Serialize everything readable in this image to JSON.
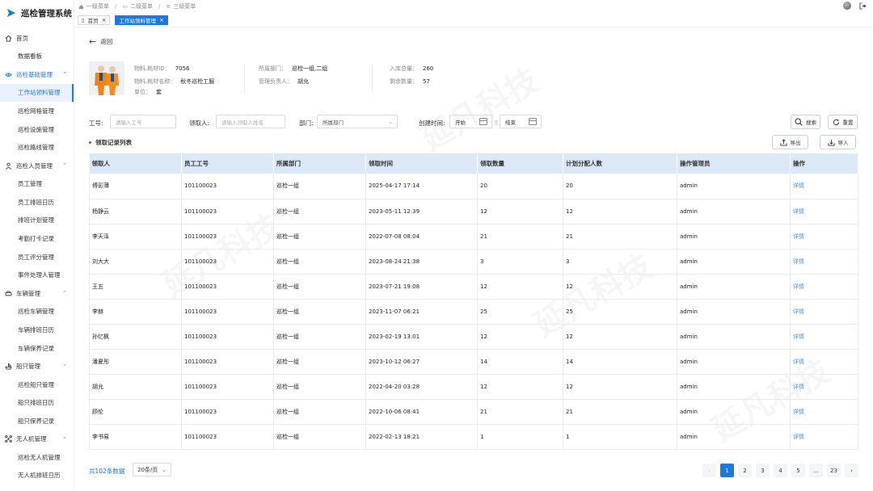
{
  "app": {
    "title": "巡检管理系统"
  },
  "breadcrumb": [
    "一级菜单",
    "二级菜单",
    "三级菜单"
  ],
  "tabs": [
    {
      "label": "首页",
      "active": false
    },
    {
      "label": "工作站领料管理",
      "active": true
    }
  ],
  "sidebar": {
    "groups": [
      {
        "label": "首页",
        "icon": "home-icon",
        "active": false,
        "items": [
          {
            "label": "数据看板",
            "active": false
          }
        ]
      },
      {
        "label": "巡检基础管理",
        "icon": "inspection-icon",
        "active": true,
        "items": [
          {
            "label": "工作站领料管理",
            "active": true
          },
          {
            "label": "巡检网格管理",
            "active": false
          },
          {
            "label": "巡检设施管理",
            "active": false
          },
          {
            "label": "巡检路线管理",
            "active": false
          }
        ]
      },
      {
        "label": "巡检人员管理",
        "icon": "person-icon",
        "active": false,
        "items": [
          {
            "label": "员工管理",
            "active": false
          },
          {
            "label": "员工排班日历",
            "active": false
          },
          {
            "label": "排班计划管理",
            "active": false
          },
          {
            "label": "考勤打卡记录",
            "active": false
          },
          {
            "label": "员工评分管理",
            "active": false
          },
          {
            "label": "事件处理人管理",
            "active": false
          }
        ]
      },
      {
        "label": "车辆管理",
        "icon": "car-icon",
        "active": false,
        "items": [
          {
            "label": "巡检车辆管理",
            "active": false
          },
          {
            "label": "车辆排班日历",
            "active": false
          },
          {
            "label": "车辆保养记录",
            "active": false
          }
        ]
      },
      {
        "label": "船只管理",
        "icon": "boat-icon",
        "active": false,
        "items": [
          {
            "label": "巡检船只管理",
            "active": false
          },
          {
            "label": "船只排班日历",
            "active": false
          },
          {
            "label": "船只保养记录",
            "active": false
          }
        ]
      },
      {
        "label": "无人机管理",
        "icon": "drone-icon",
        "active": false,
        "items": [
          {
            "label": "巡检无人机管理",
            "active": false
          },
          {
            "label": "无人机排班日历",
            "active": false
          }
        ]
      }
    ]
  },
  "back_label": "返回",
  "material": {
    "id_label": "物料,耗材ID：",
    "id_value": "7056",
    "name_label": "物料,耗材名称：",
    "name_value": "秋冬巡检工服",
    "unit_label": "单位：",
    "unit_value": "套",
    "dept_label": "所属部门：",
    "dept_value": "巡检一组,二组",
    "manager_label": "管理负责人：",
    "manager_value": "胡允",
    "in_total_label": "入库总量：",
    "in_total_value": "260",
    "remain_label": "剩余数量：",
    "remain_value": "57"
  },
  "filters": {
    "job_no_label": "工号:",
    "job_no_placeholder": "请输入工号",
    "receiver_label": "领取人:",
    "receiver_placeholder": "请输入领取人姓名",
    "dept_label": "部门:",
    "dept_value": "所属部门",
    "created_label": "创建时间:",
    "start_placeholder": "开始",
    "range_sep": "至",
    "end_placeholder": "结束",
    "search_label": "搜索",
    "reset_label": "重置"
  },
  "list": {
    "title": "领取记录列表",
    "export_label": "导出",
    "import_label": "导入"
  },
  "table": {
    "columns": [
      "领取人",
      "员工工号",
      "所属部门",
      "领取时间",
      "领取数量",
      "计划分配人数",
      "操作管理员",
      "操作"
    ],
    "rows": [
      [
        "傅彭薄",
        "101100023",
        "巡检一组",
        "2025-04-17 17:14",
        "20",
        "20",
        "admin",
        "详情"
      ],
      [
        "杨静云",
        "101100023",
        "巡检一组",
        "2023-05-11 12:39",
        "12",
        "12",
        "admin",
        "详情"
      ],
      [
        "李天泽",
        "101100023",
        "巡检一组",
        "2022-07-08 08:04",
        "21",
        "21",
        "admin",
        "详情"
      ],
      [
        "刘大大",
        "101100023",
        "巡检一组",
        "2023-08-24 21:38",
        "3",
        "3",
        "admin",
        "详情"
      ],
      [
        "王五",
        "101100023",
        "巡检一组",
        "2023-07-21 19:08",
        "12",
        "12",
        "admin",
        "详情"
      ],
      [
        "李赫",
        "101100023",
        "巡检一组",
        "2023-11-07 06:21",
        "25",
        "25",
        "admin",
        "详情"
      ],
      [
        "孙忆枫",
        "101100023",
        "巡检一组",
        "2023-02-19 13:01",
        "12",
        "12",
        "admin",
        "详情"
      ],
      [
        "潘夏彤",
        "101100023",
        "巡检一组",
        "2023-10-12 06:27",
        "14",
        "14",
        "admin",
        "详情"
      ],
      [
        "胡允",
        "101100023",
        "巡检一组",
        "2022-04-20 03:28",
        "12",
        "12",
        "admin",
        "详情"
      ],
      [
        "顾伦",
        "101100023",
        "巡检一组",
        "2022-10-06 08:41",
        "21",
        "21",
        "admin",
        "详情"
      ],
      [
        "李书易",
        "101100023",
        "巡检一组",
        "2022-02-13 18:21",
        "1",
        "1",
        "admin",
        "详情"
      ]
    ]
  },
  "pagination": {
    "total_text": "共102条数据",
    "page_size": "20条/页",
    "pages": [
      "1",
      "2",
      "3",
      "4",
      "5",
      "…",
      "23"
    ],
    "current": "1"
  },
  "watermark": "延凡科技",
  "colors": {
    "primary": "#1d78d8",
    "header_bg": "#dbe8f6"
  }
}
